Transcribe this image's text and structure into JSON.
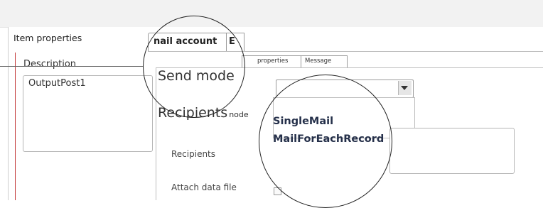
{
  "panel": {
    "title": "Item properties",
    "description_label": "Description",
    "description_value": "OutputPost1"
  },
  "tabs": [
    {
      "label": "nail account",
      "active": true
    },
    {
      "label": "E"
    }
  ],
  "subtabs": [
    {
      "label": "properties"
    },
    {
      "label": "Message"
    }
  ],
  "form": {
    "send_mode_label": "Send mode",
    "recipients_mode_label": "Recipients",
    "recipients_mode_label_suffix": "node",
    "recipients_mode_options": [
      "SingleMail",
      "MailForEachRecord"
    ],
    "recipients_label": "Recipients",
    "attach_label": "Attach data file"
  },
  "icons": {
    "dropdown": "chevron-down-icon",
    "checkbox": "checkbox-icon"
  }
}
